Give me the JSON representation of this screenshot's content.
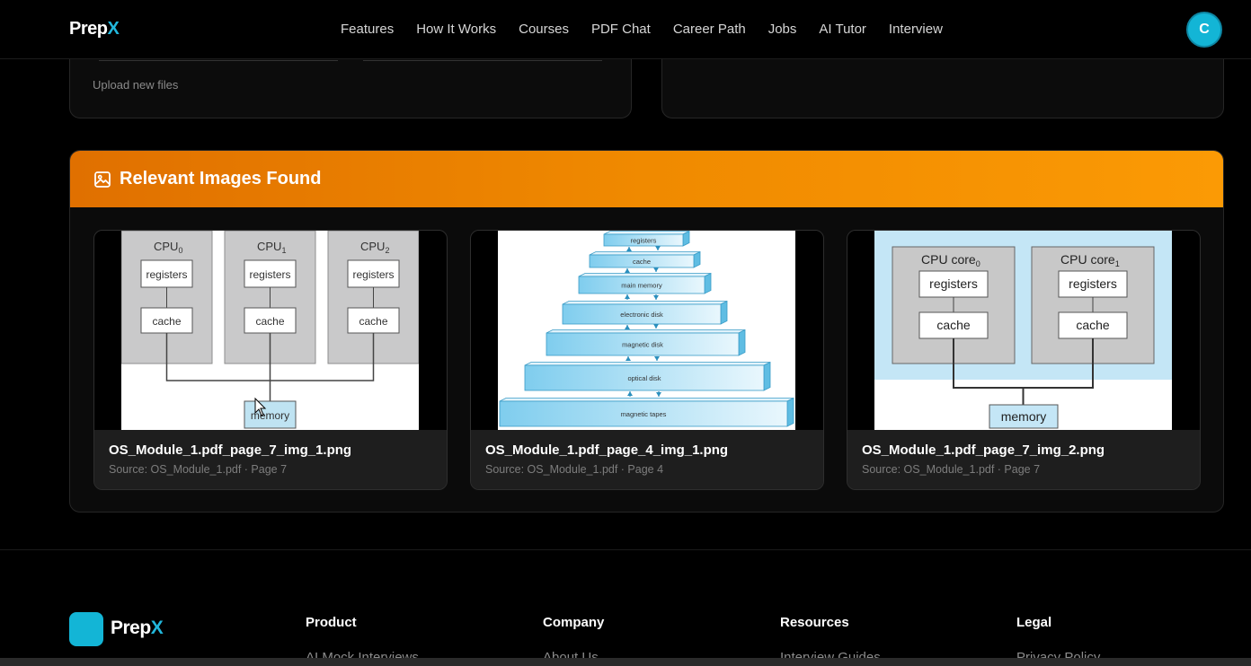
{
  "nav": {
    "brand": "Prep",
    "brand_accent": "X",
    "links": [
      "Features",
      "How It Works",
      "Courses",
      "PDF Chat",
      "Career Path",
      "Jobs",
      "AI Tutor",
      "Interview"
    ],
    "avatar_initial": "C"
  },
  "upload": {
    "link_text": "Upload new files"
  },
  "relevant_images": {
    "title": "Relevant Images Found",
    "icon": "image-icon",
    "cards": [
      {
        "name": "OS_Module_1.pdf_page_7_img_1.png",
        "source": "Source: OS_Module_1.pdf · Page 7"
      },
      {
        "name": "OS_Module_1.pdf_page_4_img_1.png",
        "source": "Source: OS_Module_1.pdf · Page 4"
      },
      {
        "name": "OS_Module_1.pdf_page_7_img_2.png",
        "source": "Source: OS_Module_1.pdf · Page 7"
      }
    ],
    "diagram1": {
      "cpus": [
        "CPU",
        "CPU",
        "CPU"
      ],
      "subs": [
        "0",
        "1",
        "2"
      ],
      "registers": "registers",
      "cache": "cache",
      "memory": "memory"
    },
    "diagram2": {
      "levels": [
        "registers",
        "cache",
        "main memory",
        "electronic disk",
        "magnetic disk",
        "optical disk",
        "magnetic tapes"
      ]
    },
    "diagram3": {
      "cores": [
        "CPU core",
        "CPU core"
      ],
      "subs": [
        "0",
        "1"
      ],
      "registers": "registers",
      "cache": "cache",
      "memory": "memory"
    }
  },
  "footer": {
    "brand": "Prep",
    "brand_accent": "X",
    "columns": [
      {
        "heading": "Product",
        "item": "AI Mock Interviews"
      },
      {
        "heading": "Company",
        "item": "About Us"
      },
      {
        "heading": "Resources",
        "item": "Interview Guides"
      },
      {
        "heading": "Legal",
        "item": "Privacy Policy"
      }
    ]
  },
  "colors": {
    "accent": "#13b5d6",
    "header_gradient_start": "#e07000",
    "header_gradient_end": "#fb9a05"
  }
}
